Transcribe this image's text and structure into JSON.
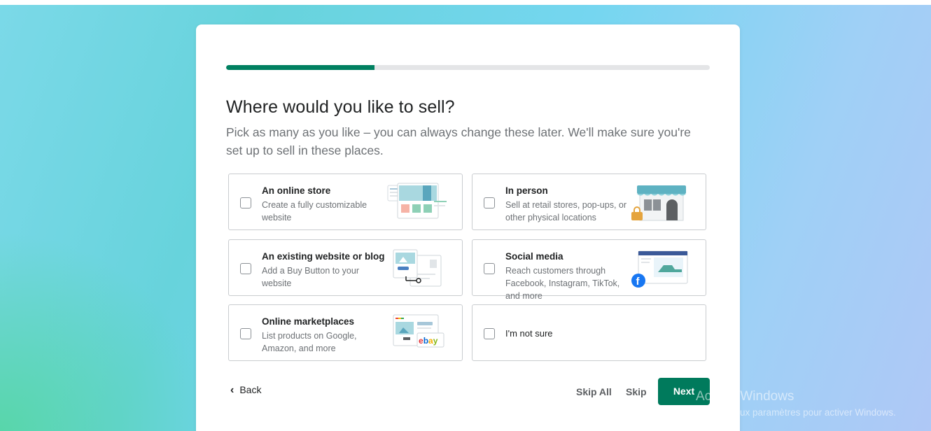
{
  "progress": {
    "fraction": 0.307
  },
  "title": "Where would you like to sell?",
  "subtitle": "Pick as many as you like – you can always change these later. We'll make sure you're set up to sell in these places.",
  "options": [
    {
      "title": "An online store",
      "description": "Create a fully customizable website",
      "checked": false,
      "icon": "online-store-illustration"
    },
    {
      "title": "In person",
      "description": "Sell at retail stores, pop-ups, or other physical locations",
      "checked": false,
      "icon": "storefront-illustration"
    },
    {
      "title": "An existing website or blog",
      "description": "Add a Buy Button to your website",
      "checked": false,
      "icon": "buy-button-illustration"
    },
    {
      "title": "Social media",
      "description": "Reach customers through Facebook, Instagram, TikTok, and more",
      "checked": false,
      "icon": "social-media-illustration"
    },
    {
      "title": "Online marketplaces",
      "description": "List products on Google, Amazon, and more",
      "checked": false,
      "icon": "marketplace-illustration"
    },
    {
      "title": "I'm not sure",
      "checked": false
    }
  ],
  "footer": {
    "back_label": "Back",
    "skip_all_label": "Skip All",
    "skip_label": "Skip",
    "next_label": "Next"
  },
  "watermark": {
    "title": "Activer Windows",
    "subtitle": "Accédez aux paramètres pour activer Windows."
  },
  "colors": {
    "accent": "#008060",
    "next_button": "#007a5c",
    "facebook": "#1877f2",
    "ebay_red": "#e53238",
    "ebay_blue": "#0064d2"
  }
}
